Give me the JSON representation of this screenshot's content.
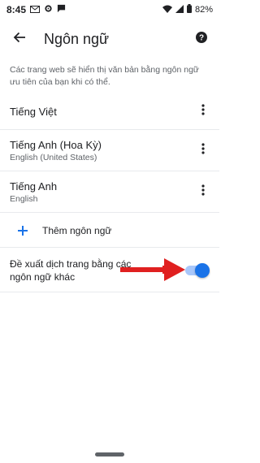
{
  "status_bar": {
    "time": "8:45",
    "battery": "82%",
    "icons": [
      "mail-icon",
      "gear-icon",
      "chat-icon",
      "wifi-icon",
      "signal-icon",
      "battery-icon"
    ]
  },
  "app_bar": {
    "title": "Ngôn ngữ",
    "back_icon": "arrow-back-icon",
    "help_icon": "help-icon"
  },
  "description": "Các trang web sẽ hiển thị văn bản bằng ngôn ngữ ưu tiên của bạn khi có thể.",
  "languages": [
    {
      "name": "Tiếng Việt",
      "subtitle": ""
    },
    {
      "name": "Tiếng Anh (Hoa Kỳ)",
      "subtitle": "English (United States)"
    },
    {
      "name": "Tiếng Anh",
      "subtitle": "English"
    }
  ],
  "add_language": {
    "label": "Thêm ngôn ngữ",
    "icon": "plus-icon"
  },
  "offer_translate": {
    "label": "Đề xuất dịch trang bằng các ngôn ngữ khác",
    "enabled": true
  },
  "colors": {
    "accent": "#1a73e8",
    "toggle_track": "#a8c7fa",
    "arrow": "#e02020",
    "divider": "#e8eaed",
    "secondary_text": "#5f6368"
  }
}
